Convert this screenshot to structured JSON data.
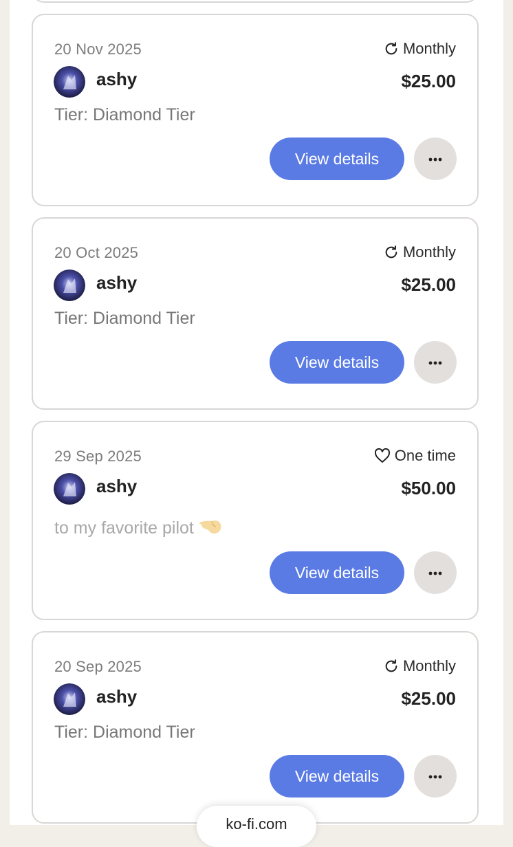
{
  "cards": [
    {
      "date": "20 Nov 2025",
      "frequency": "Monthly",
      "frequency_icon": "refresh-icon",
      "name": "ashy",
      "amount": "$25.00",
      "detail": "Tier: Diamond Tier",
      "view_label": "View details"
    },
    {
      "date": "20 Oct 2025",
      "frequency": "Monthly",
      "frequency_icon": "refresh-icon",
      "name": "ashy",
      "amount": "$25.00",
      "detail": "Tier: Diamond Tier",
      "view_label": "View details"
    },
    {
      "date": "29 Sep 2025",
      "frequency": "One time",
      "frequency_icon": "heart-icon",
      "name": "ashy",
      "amount": "$50.00",
      "message": "to my favorite pilot",
      "view_label": "View details"
    },
    {
      "date": "20 Sep 2025",
      "frequency": "Monthly",
      "frequency_icon": "refresh-icon",
      "name": "ashy",
      "amount": "$25.00",
      "detail": "Tier: Diamond Tier",
      "view_label": "View details"
    }
  ],
  "footer": {
    "domain": "ko-fi.com"
  },
  "colors": {
    "accent": "#5a7be4",
    "card_border": "#d9d6d4",
    "more_button": "#e2dfdd",
    "page_background": "#f2efe9"
  }
}
